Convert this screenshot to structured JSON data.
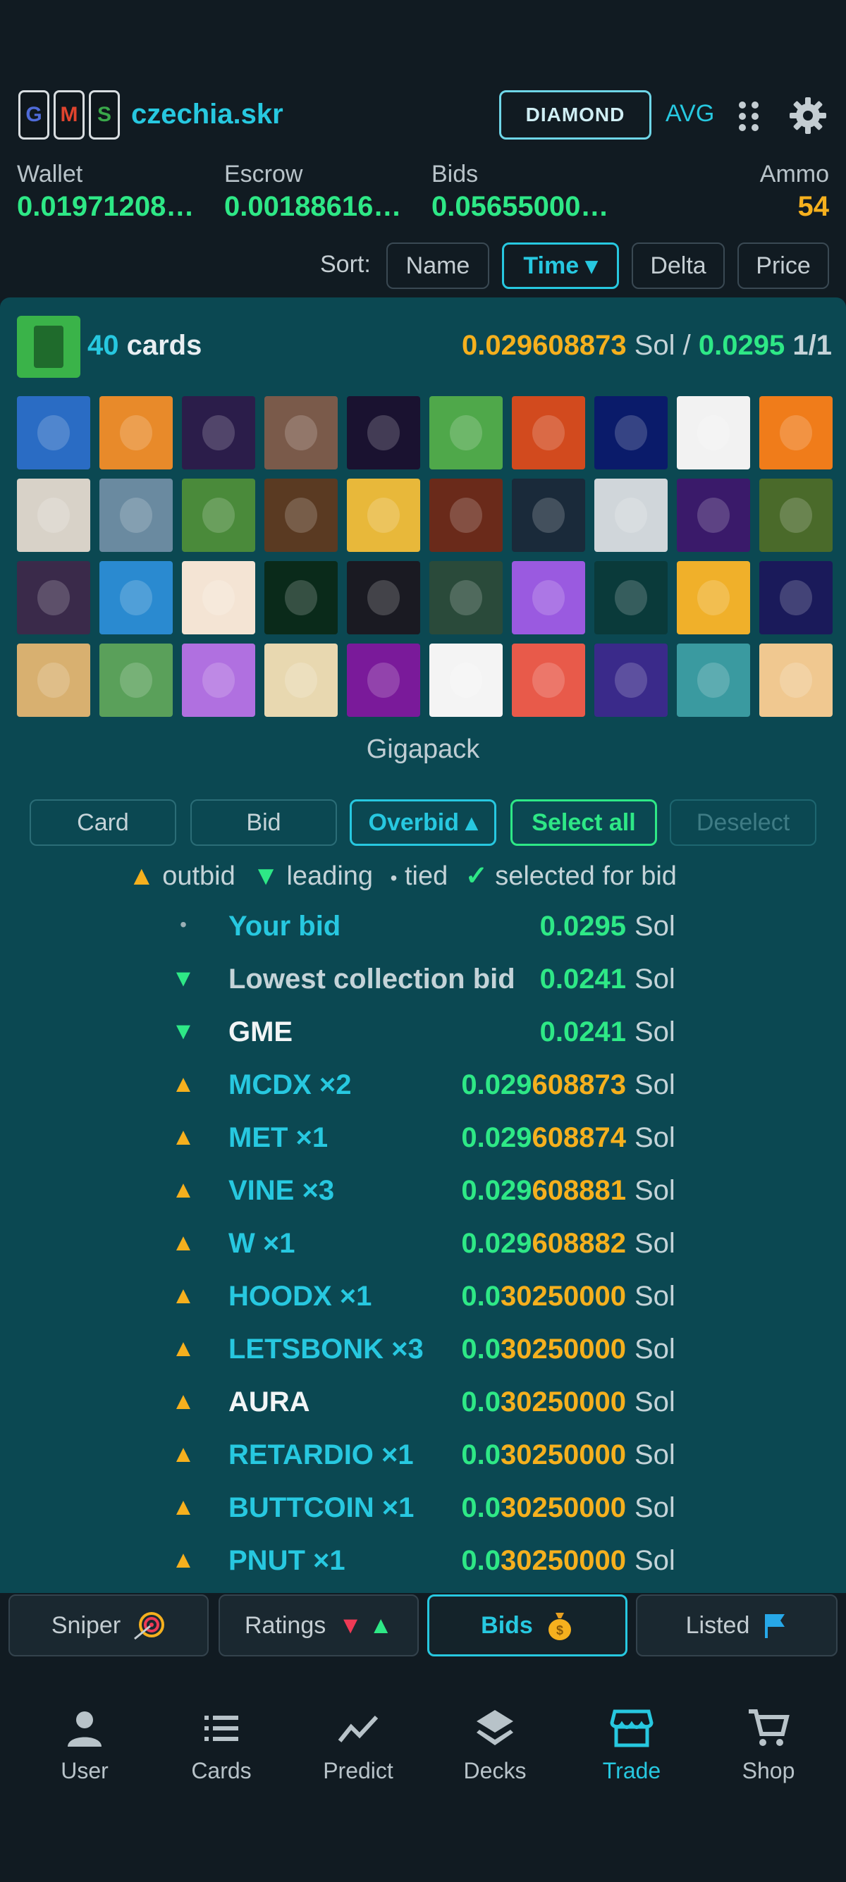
{
  "header": {
    "gms_letters": [
      {
        "letter": "G",
        "color": "#4f6bd8"
      },
      {
        "letter": "M",
        "color": "#e0442e"
      },
      {
        "letter": "S",
        "color": "#3aa84a"
      }
    ],
    "username": "czechia.skr",
    "tier_label": "DIAMOND",
    "avg_label": "AVG",
    "icons": [
      "apps-grid-icon",
      "gear-icon"
    ]
  },
  "balances": [
    {
      "label": "Wallet",
      "value": "0.01971208…",
      "color": "#2ee886"
    },
    {
      "label": "Escrow",
      "value": "0.00188616…",
      "color": "#2ee886"
    },
    {
      "label": "Bids",
      "value": "0.05655000…",
      "color": "#2ee886"
    },
    {
      "label": "Ammo",
      "value": "54",
      "color": "#f5b01e"
    }
  ],
  "sort": {
    "label": "Sort:",
    "options": [
      "Name",
      "Time ▾",
      "Delta",
      "Price"
    ],
    "active": "Time ▾"
  },
  "pack": {
    "count": "40",
    "count_suffix": "cards",
    "price_current": "0.029608873",
    "price_unit_sep": "Sol /",
    "price_bid": "0.0295",
    "ratio": "1/1",
    "name": "Gigapack",
    "thumb_colors": [
      "#2a6cc4",
      "#e88a2a",
      "#2b1d4a",
      "#7a5a4a",
      "#1a1230",
      "#4fa84a",
      "#d24a1e",
      "#0a1b6a",
      "#f2f2f2",
      "#f07c1a",
      "#d8d2c8",
      "#6a8aa0",
      "#4a8a3a",
      "#5a3a22",
      "#e8b83a",
      "#6a2a1a",
      "#1a2a3a",
      "#d0d6da",
      "#3a1a6a",
      "#4a6a2a",
      "#3a2a4a",
      "#2a8ad0",
      "#f4e4d4",
      "#0a2a1a",
      "#1a1a22",
      "#2a4a3a",
      "#9a5ae0",
      "#0a3a3a",
      "#f0b02a",
      "#1a1a5a",
      "#d8b070",
      "#5aa05a",
      "#b070e0",
      "#e8d8b0",
      "#7a1a9a",
      "#f4f4f4",
      "#e85a4a",
      "#3a2a8a",
      "#3a9aa0",
      "#f0c890"
    ]
  },
  "tools": [
    "Card",
    "Bid",
    "Overbid ▴",
    "Select all",
    "Deselect"
  ],
  "legend": {
    "outbid": "outbid",
    "leading": "leading",
    "tied": "tied",
    "selected": "selected for bid"
  },
  "bids": [
    {
      "marker": "dot",
      "name": "Your bid",
      "style": "cyan",
      "amt_green": "0.0295",
      "amt_orange": "",
      "unit": "Sol"
    },
    {
      "marker": "down",
      "name": "Lowest collection bid",
      "style": "gray",
      "amt_green": "0.0241",
      "amt_orange": "",
      "unit": "Sol"
    },
    {
      "marker": "down",
      "name": "GME",
      "style": "white",
      "amt_green": "0.0241",
      "amt_orange": "",
      "unit": "Sol"
    },
    {
      "marker": "up",
      "name": "MCDX ×2",
      "style": "cyan",
      "amt_green": "0.029",
      "amt_orange": "608873",
      "unit": "Sol"
    },
    {
      "marker": "up",
      "name": "MET ×1",
      "style": "cyan",
      "amt_green": "0.029",
      "amt_orange": "608874",
      "unit": "Sol"
    },
    {
      "marker": "up",
      "name": "VINE ×3",
      "style": "cyan",
      "amt_green": "0.029",
      "amt_orange": "608881",
      "unit": "Sol"
    },
    {
      "marker": "up",
      "name": "W ×1",
      "style": "cyan",
      "amt_green": "0.029",
      "amt_orange": "608882",
      "unit": "Sol"
    },
    {
      "marker": "up",
      "name": "HOODX ×1",
      "style": "cyan",
      "amt_green": "0.0",
      "amt_orange": "30250000",
      "unit": "Sol"
    },
    {
      "marker": "up",
      "name": "LETSBONK ×3",
      "style": "cyan",
      "amt_green": "0.0",
      "amt_orange": "30250000",
      "unit": "Sol"
    },
    {
      "marker": "up",
      "name": "AURA",
      "style": "white",
      "amt_green": "0.0",
      "amt_orange": "30250000",
      "unit": "Sol"
    },
    {
      "marker": "up",
      "name": "RETARDIO ×1",
      "style": "cyan",
      "amt_green": "0.0",
      "amt_orange": "30250000",
      "unit": "Sol"
    },
    {
      "marker": "up",
      "name": "BUTTCOIN ×1",
      "style": "cyan",
      "amt_green": "0.0",
      "amt_orange": "30250000",
      "unit": "Sol"
    },
    {
      "marker": "up",
      "name": "PNUT ×1",
      "style": "cyan",
      "amt_green": "0.0",
      "amt_orange": "30250000",
      "unit": "Sol"
    }
  ],
  "lower_tabs": [
    {
      "label": "Sniper",
      "icon": "target-icon"
    },
    {
      "label": "Ratings",
      "icon": "ratings-arrows-icon"
    },
    {
      "label": "Bids",
      "icon": "money-bag-icon"
    },
    {
      "label": "Listed",
      "icon": "flag-icon"
    }
  ],
  "nav": [
    "User",
    "Cards",
    "Predict",
    "Decks",
    "Trade",
    "Shop"
  ],
  "colors": {
    "accent": "#27c8e0",
    "green": "#2ee886",
    "orange": "#f5b01e",
    "panel": "#0b4852",
    "bg": "#111b22"
  }
}
